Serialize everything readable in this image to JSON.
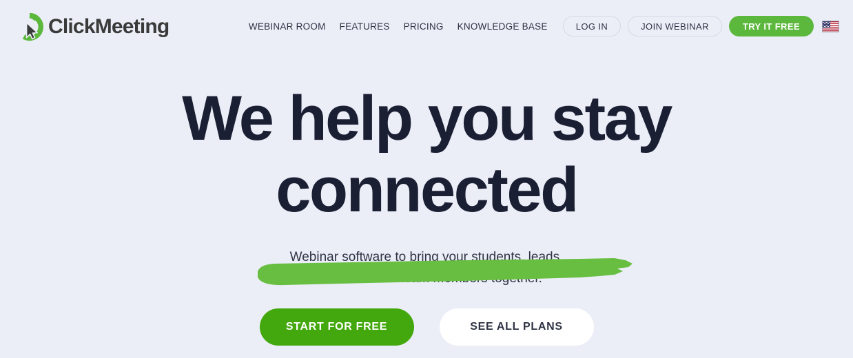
{
  "brand": {
    "name": "ClickMeeting",
    "logo_icon": "clickmeeting-cursor-logo",
    "accent_green": "#5cb83c",
    "cta_green": "#43a80d",
    "brush_green": "#68be41",
    "background": "#ebeef7",
    "text_dark": "#1b1f33"
  },
  "nav": {
    "links": [
      {
        "label": "WEBINAR ROOM"
      },
      {
        "label": "FEATURES"
      },
      {
        "label": "PRICING"
      },
      {
        "label": "KNOWLEDGE BASE"
      }
    ],
    "login_label": "LOG IN",
    "join_label": "JOIN WEBINAR",
    "try_label": "TRY IT FREE",
    "language_icon": "us-flag-icon"
  },
  "hero": {
    "headline_line_1": "We help you stay",
    "headline_line_2": "connected",
    "subhead_line_1": "Webinar software to bring your students, leads,",
    "subhead_line_2": "customers and team members together.",
    "cta_primary": "START FOR FREE",
    "cta_secondary": "SEE ALL PLANS"
  }
}
